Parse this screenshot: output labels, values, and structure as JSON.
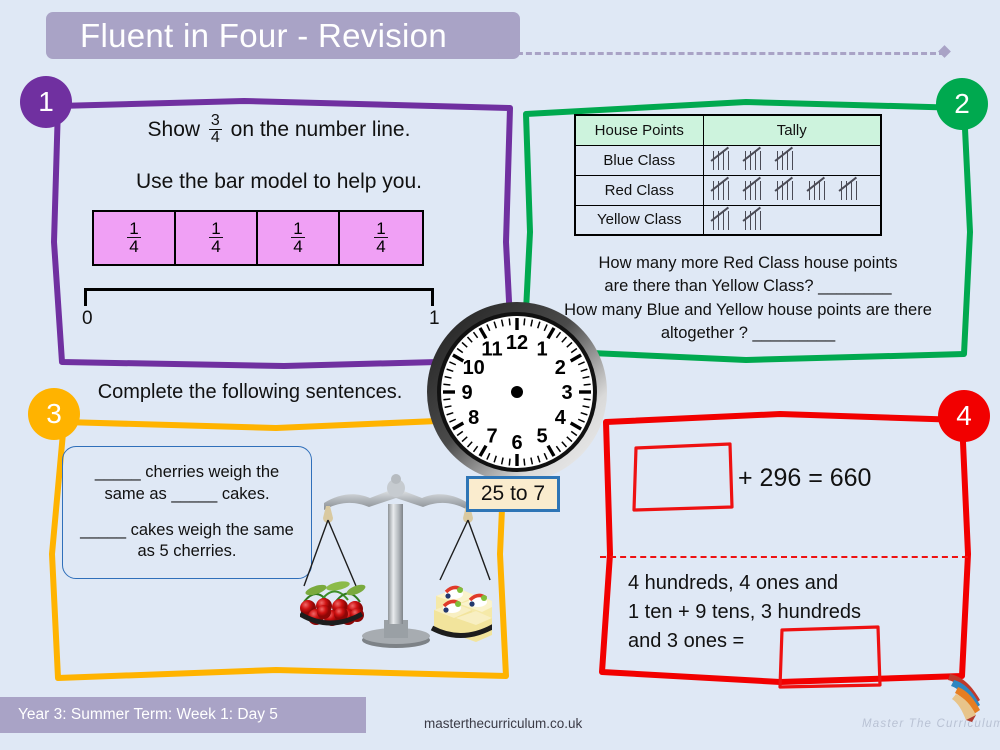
{
  "header": {
    "title": "Fluent in Four - Revision",
    "title_bg": "#a9a3c6"
  },
  "colors": {
    "background": "#dfe8f5",
    "panel1": "#7030a0",
    "panel2": "#00a94f",
    "panel3": "#ffb300",
    "panel4": "#f20000",
    "bar_fill": "#f0a0f5",
    "table_header": "#cdf3dd",
    "clock_label_bg": "#faecce",
    "clock_label_border": "#2e75b6"
  },
  "panels": [
    {
      "number": "1",
      "accent": "#7030a0",
      "line1_before": "Show",
      "fraction": {
        "numerator": "3",
        "denominator": "4"
      },
      "line1_after": "on the number line.",
      "line2": "Use the bar model to help you.",
      "bar_model": [
        {
          "numerator": "1",
          "denominator": "4"
        },
        {
          "numerator": "1",
          "denominator": "4"
        },
        {
          "numerator": "1",
          "denominator": "4"
        },
        {
          "numerator": "1",
          "denominator": "4"
        }
      ],
      "number_line": {
        "start_label": "0",
        "end_label": "1"
      }
    },
    {
      "number": "2",
      "accent": "#00a94f",
      "table": {
        "headers": [
          "House Points",
          "Tally"
        ],
        "rows": [
          {
            "label": "Blue Class",
            "tally_groups": 3,
            "tally_count": 15
          },
          {
            "label": "Red Class",
            "tally_groups": 5,
            "tally_count": 25
          },
          {
            "label": "Yellow Class",
            "tally_groups": 2,
            "tally_count": 10
          }
        ]
      },
      "question_line1": "How many more Red Class house points",
      "question_line2": "are there than Yellow Class? ________",
      "question_line3": "How many Blue and Yellow house points are there",
      "question_line4": "altogether ? _________"
    },
    {
      "number": "3",
      "accent": "#ffb300",
      "heading": "Complete the following sentences.",
      "sentence1_line1": "_____ cherries weigh the",
      "sentence1_line2": "same as _____ cakes.",
      "sentence2_line1": "_____ cakes weigh the same",
      "sentence2_line2": "as 5 cherries.",
      "illustration": "balance-scale-cherries-cakes",
      "cherries_count": 10,
      "cakes_count": 4
    },
    {
      "number": "4",
      "accent": "#f20000",
      "equation_text": "+ 296 = 660",
      "equation_missing_box": "",
      "place_value_line1": "4 hundreds, 4 ones and",
      "place_value_line2": "1 ten + 9 tens, 3 hundreds",
      "place_value_line3": "and 3 ones =",
      "place_value_answer_box": ""
    }
  ],
  "clock": {
    "numerals": [
      "12",
      "1",
      "2",
      "3",
      "4",
      "5",
      "6",
      "7",
      "8",
      "9",
      "10",
      "11"
    ],
    "hands_shown": false,
    "label": "25 to 7"
  },
  "footer": {
    "lesson_info": "Year 3: Summer Term: Week 1: Day  5",
    "site": "masterthecurriculum.co.uk",
    "watermark": "Master  The  Curriculum"
  }
}
